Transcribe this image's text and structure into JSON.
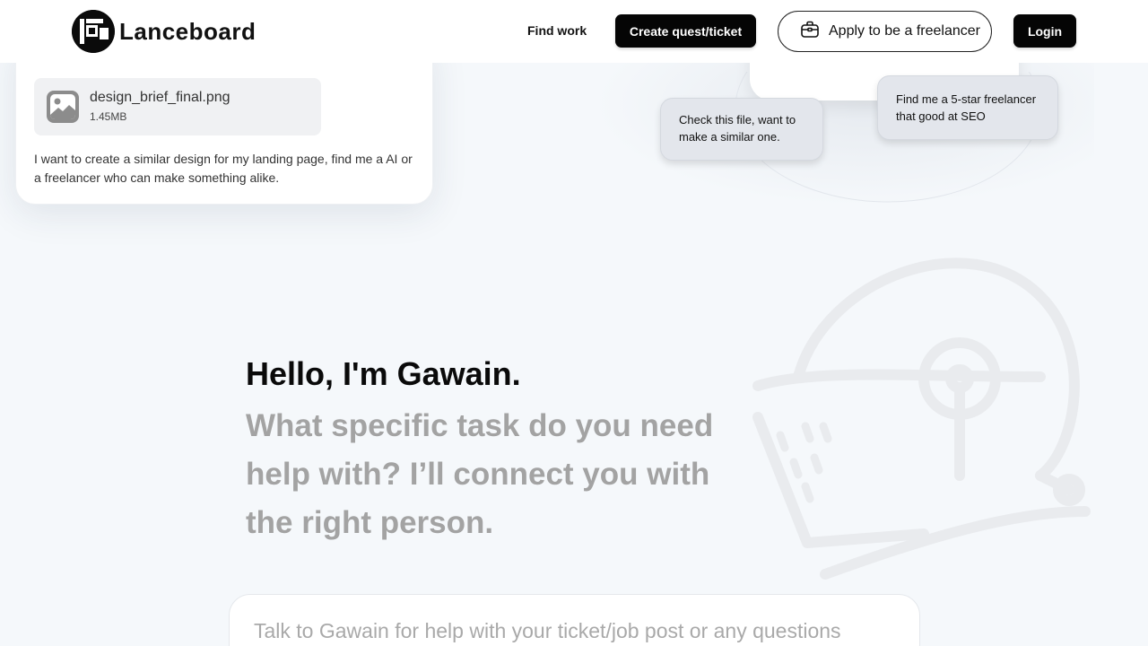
{
  "header": {
    "logo_text": "Lanceboard",
    "nav_find_work": "Find work",
    "create_button": "Create quest/ticket",
    "apply_button": "Apply to be a freelancer",
    "login_button": "Login"
  },
  "example_card": {
    "file_name": "design_brief_final.png",
    "file_size": "1.45MB",
    "message": "I want to create a similar design for my landing page, find me a AI or a freelancer who can make something alike."
  },
  "bubbles": {
    "bubble_1": "Check this file, want to make a similar one.",
    "bubble_2": "Find me a 5-star freelancer that good at SEO"
  },
  "hero": {
    "title": "Hello, I'm Gawain.",
    "subtitle": "What specific task do you need help with? I’ll connect you with the right person."
  },
  "chat": {
    "placeholder": "Talk to Gawain for help with your ticket/job post or any questions"
  },
  "colors": {
    "background": "#f5f8fb",
    "primary_dark": "#050505",
    "muted_text": "#a3a3a3"
  }
}
